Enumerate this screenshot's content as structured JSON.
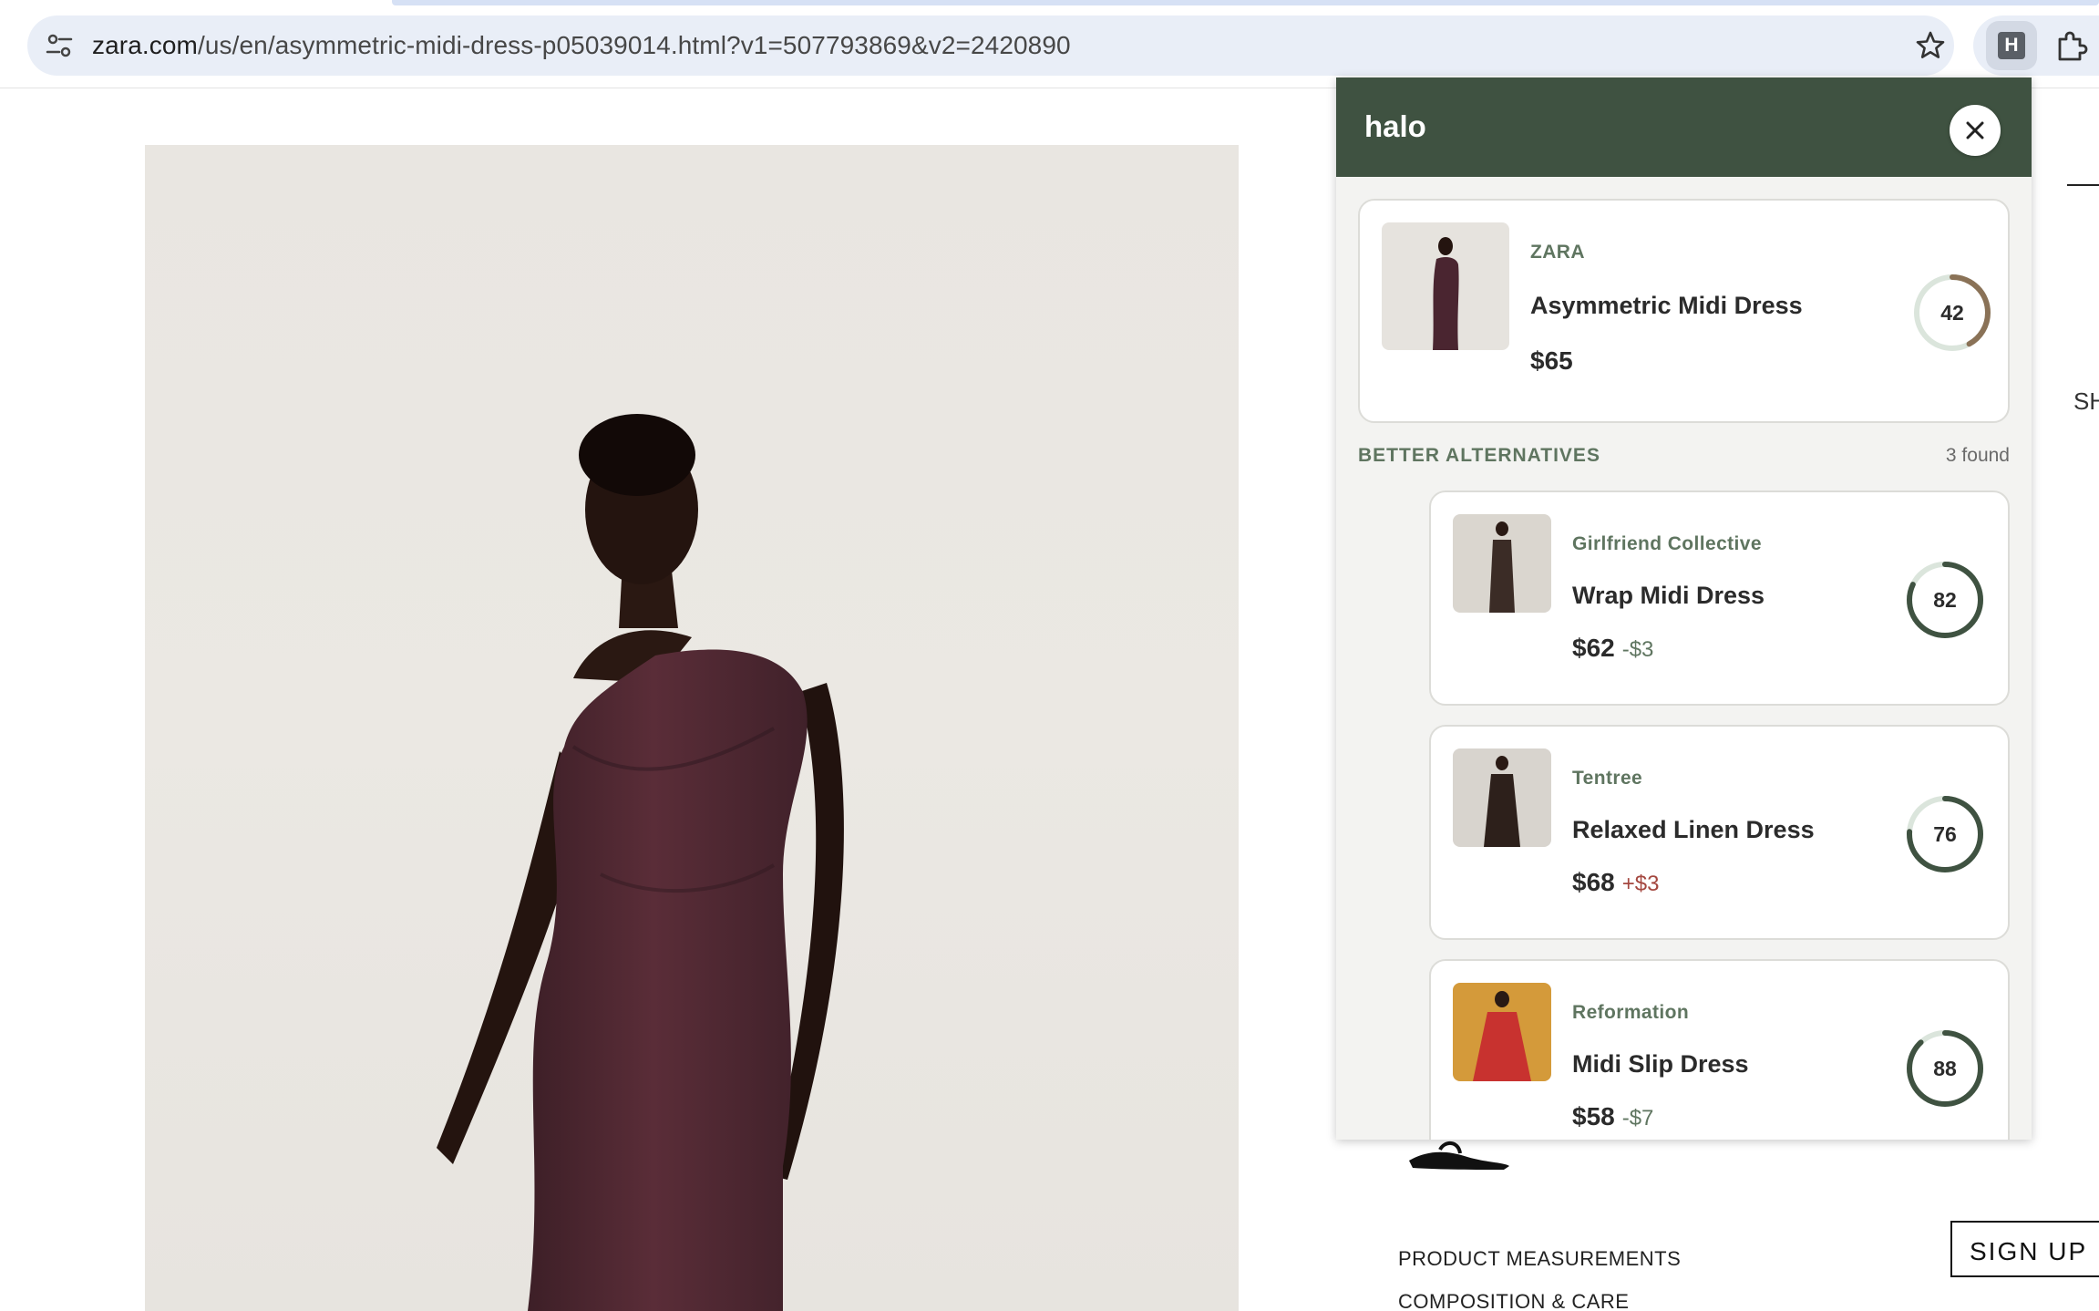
{
  "browser": {
    "url_host": "zara.com",
    "url_path": "/us/en/asymmetric-midi-dress-p05039014.html?v1=507793869&v2=2420890",
    "site_info_icon": "tune-icon",
    "bookmark_icon": "star-icon",
    "extension_icon": "halo-extension-icon",
    "extensions_menu_icon": "puzzle-icon"
  },
  "page": {
    "right_edge_text": "SH",
    "product_measurements": "PRODUCT MEASUREMENTS",
    "composition_care": "COMPOSITION & CARE",
    "signup_label": "SIGN UP"
  },
  "halo": {
    "title": "halo",
    "close_icon": "close-icon",
    "current": {
      "brand": "ZARA",
      "name": "Asymmetric Midi Dress",
      "price": "$65",
      "score": 42,
      "score_color": "#8a7257"
    },
    "alternatives_label": "BETTER ALTERNATIVES",
    "alternatives_count": "3 found",
    "alternatives": [
      {
        "brand": "Girlfriend Collective",
        "name": "Wrap Midi Dress",
        "price": "$62",
        "delta": "-$3",
        "score": 82,
        "score_color": "#3f5241"
      },
      {
        "brand": "Tentree",
        "name": "Relaxed Linen Dress",
        "price": "$68",
        "delta": "+$3",
        "score": 76,
        "score_color": "#3f5241"
      },
      {
        "brand": "Reformation",
        "name": "Midi Slip Dress",
        "price": "$58",
        "delta": "-$7",
        "score": 88,
        "score_color": "#3f5241"
      }
    ],
    "accent_color": "#3f5241",
    "track_color": "#dbe5dc"
  }
}
